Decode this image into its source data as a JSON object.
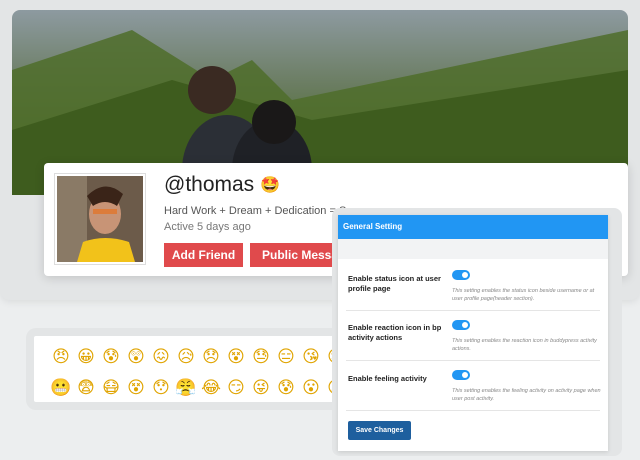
{
  "profile": {
    "username": "@thomas",
    "username_emoji": "🤩",
    "tagline": "Hard Work + Dream + Dedication = Success",
    "last_active": "Active 5 days ago",
    "add_friend_label": "Add Friend",
    "public_message_label": "Public Message"
  },
  "emojis": {
    "row1": [
      "😠",
      "😀",
      "😰",
      "😲",
      "😖",
      "😥",
      "😞",
      "😵",
      "😓",
      "😑",
      "😘",
      "😊"
    ],
    "row2": [
      "😬",
      "😨",
      "😷",
      "😵",
      "😯",
      "😤",
      "😂",
      "😏",
      "😜",
      "😰",
      "😮",
      "☹"
    ]
  },
  "settings": {
    "header": "General Setting",
    "rows": [
      {
        "label": "Enable status icon at user profile page",
        "description": "This setting enables the status icon beside username or at user profile page(header section).",
        "enabled": true
      },
      {
        "label": "Enable reaction icon in bp activity actions",
        "description": "This setting enables the reaction icon in buddypress activity actions.",
        "enabled": true
      },
      {
        "label": "Enable feeling activity",
        "description": "This setting enables the feeling activity on activity page when user post activity.",
        "enabled": true
      }
    ],
    "save_label": "Save Changes"
  },
  "colors": {
    "accent_blue": "#2196f3",
    "button_red": "#e04a4c",
    "save_blue": "#1e5f9e"
  }
}
